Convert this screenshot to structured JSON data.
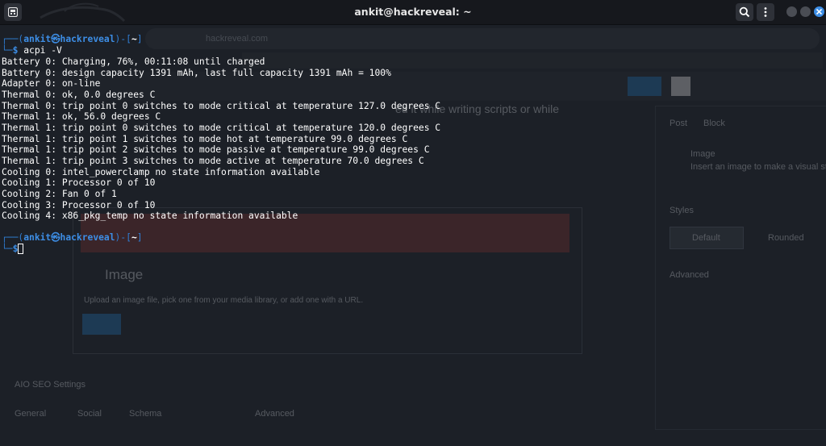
{
  "window": {
    "title": "ankit@hackreveal: ~"
  },
  "icons": {
    "terminal_menu": "terminal-icon",
    "search": "search-icon",
    "menu": "kebab-menu-icon",
    "minimize": "minimize-icon",
    "maximize": "maximize-icon",
    "close": "close-icon"
  },
  "colors": {
    "background": "#1c2027",
    "prompt_blue": "#3d8ee6",
    "text": "#ffffff",
    "close_button": "#3d8ee6"
  },
  "terminal": {
    "prompt1": {
      "frame_top_left": "┌──(",
      "user_host": "ankit㉿hackreveal",
      "sep": ")-[",
      "dir": "~",
      "end": "]",
      "frame_bottom": "└─",
      "sign": "$",
      "command": "acpi -V"
    },
    "output": [
      "Battery 0: Charging, 76%, 00:11:08 until charged",
      "Battery 0: design capacity 1391 mAh, last full capacity 1391 mAh = 100%",
      "Adapter 0: on-line",
      "Thermal 0: ok, 0.0 degrees C",
      "Thermal 0: trip point 0 switches to mode critical at temperature 127.0 degrees C",
      "Thermal 1: ok, 56.0 degrees C",
      "Thermal 1: trip point 0 switches to mode critical at temperature 120.0 degrees C",
      "Thermal 1: trip point 1 switches to mode hot at temperature 99.0 degrees C",
      "Thermal 1: trip point 2 switches to mode passive at temperature 99.0 degrees C",
      "Thermal 1: trip point 3 switches to mode active at temperature 70.0 degrees C",
      "Cooling 0: intel_powerclamp no state information available",
      "Cooling 1: Processor 0 of 10",
      "Cooling 2: Fan 0 of 1",
      "Cooling 3: Processor 0 of 10",
      "Cooling 4: x86_pkg_temp no state information available"
    ],
    "prompt2": {
      "frame_top_left": "┌──(",
      "user_host": "ankit㉿hackreveal",
      "sep": ")-[",
      "dir": "~",
      "end": "]",
      "frame_bottom": "└─",
      "sign": "$"
    }
  },
  "background_ghost": {
    "url": "hackreveal.com",
    "editor_heading_fragment": "ed it while writing scripts or while",
    "block_title": "Image",
    "block_description": "Upload an image file, pick one from your media library, or add one with a URL.",
    "sidebar_tabs": [
      "Post",
      "Block"
    ],
    "sidebar_block_name": "Image",
    "sidebar_block_desc": "Insert an image to make a visual statement.",
    "styles_label": "Styles",
    "style_default": "Default",
    "style_rounded": "Rounded",
    "advanced_label": "Advanced",
    "seo_panel_title": "AIO SEO Settings",
    "seo_tabs": [
      "General",
      "Social",
      "Schema",
      "Advanced"
    ]
  }
}
